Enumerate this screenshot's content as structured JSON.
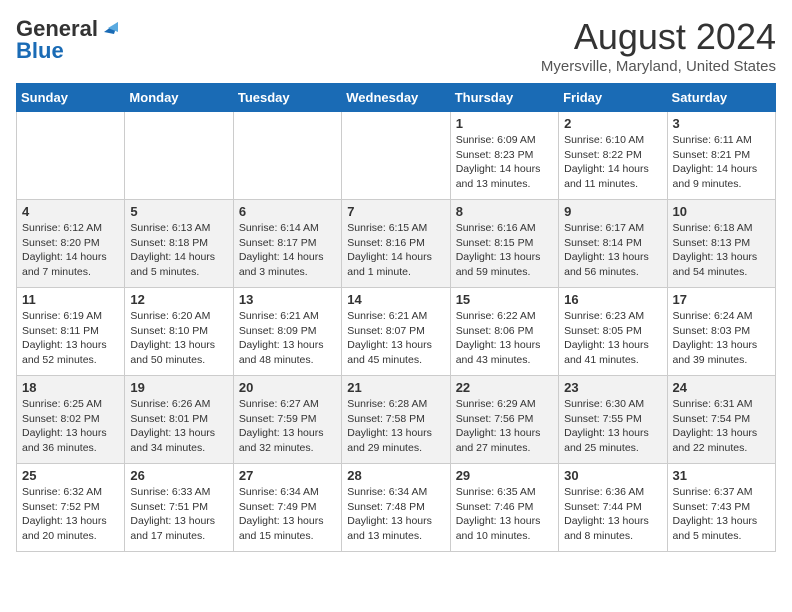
{
  "header": {
    "logo_line1": "General",
    "logo_line2": "Blue",
    "month_title": "August 2024",
    "location": "Myersville, Maryland, United States"
  },
  "weekdays": [
    "Sunday",
    "Monday",
    "Tuesday",
    "Wednesday",
    "Thursday",
    "Friday",
    "Saturday"
  ],
  "weeks": [
    [
      {
        "day": "",
        "info": ""
      },
      {
        "day": "",
        "info": ""
      },
      {
        "day": "",
        "info": ""
      },
      {
        "day": "",
        "info": ""
      },
      {
        "day": "1",
        "info": "Sunrise: 6:09 AM\nSunset: 8:23 PM\nDaylight: 14 hours\nand 13 minutes."
      },
      {
        "day": "2",
        "info": "Sunrise: 6:10 AM\nSunset: 8:22 PM\nDaylight: 14 hours\nand 11 minutes."
      },
      {
        "day": "3",
        "info": "Sunrise: 6:11 AM\nSunset: 8:21 PM\nDaylight: 14 hours\nand 9 minutes."
      }
    ],
    [
      {
        "day": "4",
        "info": "Sunrise: 6:12 AM\nSunset: 8:20 PM\nDaylight: 14 hours\nand 7 minutes."
      },
      {
        "day": "5",
        "info": "Sunrise: 6:13 AM\nSunset: 8:18 PM\nDaylight: 14 hours\nand 5 minutes."
      },
      {
        "day": "6",
        "info": "Sunrise: 6:14 AM\nSunset: 8:17 PM\nDaylight: 14 hours\nand 3 minutes."
      },
      {
        "day": "7",
        "info": "Sunrise: 6:15 AM\nSunset: 8:16 PM\nDaylight: 14 hours\nand 1 minute."
      },
      {
        "day": "8",
        "info": "Sunrise: 6:16 AM\nSunset: 8:15 PM\nDaylight: 13 hours\nand 59 minutes."
      },
      {
        "day": "9",
        "info": "Sunrise: 6:17 AM\nSunset: 8:14 PM\nDaylight: 13 hours\nand 56 minutes."
      },
      {
        "day": "10",
        "info": "Sunrise: 6:18 AM\nSunset: 8:13 PM\nDaylight: 13 hours\nand 54 minutes."
      }
    ],
    [
      {
        "day": "11",
        "info": "Sunrise: 6:19 AM\nSunset: 8:11 PM\nDaylight: 13 hours\nand 52 minutes."
      },
      {
        "day": "12",
        "info": "Sunrise: 6:20 AM\nSunset: 8:10 PM\nDaylight: 13 hours\nand 50 minutes."
      },
      {
        "day": "13",
        "info": "Sunrise: 6:21 AM\nSunset: 8:09 PM\nDaylight: 13 hours\nand 48 minutes."
      },
      {
        "day": "14",
        "info": "Sunrise: 6:21 AM\nSunset: 8:07 PM\nDaylight: 13 hours\nand 45 minutes."
      },
      {
        "day": "15",
        "info": "Sunrise: 6:22 AM\nSunset: 8:06 PM\nDaylight: 13 hours\nand 43 minutes."
      },
      {
        "day": "16",
        "info": "Sunrise: 6:23 AM\nSunset: 8:05 PM\nDaylight: 13 hours\nand 41 minutes."
      },
      {
        "day": "17",
        "info": "Sunrise: 6:24 AM\nSunset: 8:03 PM\nDaylight: 13 hours\nand 39 minutes."
      }
    ],
    [
      {
        "day": "18",
        "info": "Sunrise: 6:25 AM\nSunset: 8:02 PM\nDaylight: 13 hours\nand 36 minutes."
      },
      {
        "day": "19",
        "info": "Sunrise: 6:26 AM\nSunset: 8:01 PM\nDaylight: 13 hours\nand 34 minutes."
      },
      {
        "day": "20",
        "info": "Sunrise: 6:27 AM\nSunset: 7:59 PM\nDaylight: 13 hours\nand 32 minutes."
      },
      {
        "day": "21",
        "info": "Sunrise: 6:28 AM\nSunset: 7:58 PM\nDaylight: 13 hours\nand 29 minutes."
      },
      {
        "day": "22",
        "info": "Sunrise: 6:29 AM\nSunset: 7:56 PM\nDaylight: 13 hours\nand 27 minutes."
      },
      {
        "day": "23",
        "info": "Sunrise: 6:30 AM\nSunset: 7:55 PM\nDaylight: 13 hours\nand 25 minutes."
      },
      {
        "day": "24",
        "info": "Sunrise: 6:31 AM\nSunset: 7:54 PM\nDaylight: 13 hours\nand 22 minutes."
      }
    ],
    [
      {
        "day": "25",
        "info": "Sunrise: 6:32 AM\nSunset: 7:52 PM\nDaylight: 13 hours\nand 20 minutes."
      },
      {
        "day": "26",
        "info": "Sunrise: 6:33 AM\nSunset: 7:51 PM\nDaylight: 13 hours\nand 17 minutes."
      },
      {
        "day": "27",
        "info": "Sunrise: 6:34 AM\nSunset: 7:49 PM\nDaylight: 13 hours\nand 15 minutes."
      },
      {
        "day": "28",
        "info": "Sunrise: 6:34 AM\nSunset: 7:48 PM\nDaylight: 13 hours\nand 13 minutes."
      },
      {
        "day": "29",
        "info": "Sunrise: 6:35 AM\nSunset: 7:46 PM\nDaylight: 13 hours\nand 10 minutes."
      },
      {
        "day": "30",
        "info": "Sunrise: 6:36 AM\nSunset: 7:44 PM\nDaylight: 13 hours\nand 8 minutes."
      },
      {
        "day": "31",
        "info": "Sunrise: 6:37 AM\nSunset: 7:43 PM\nDaylight: 13 hours\nand 5 minutes."
      }
    ]
  ]
}
